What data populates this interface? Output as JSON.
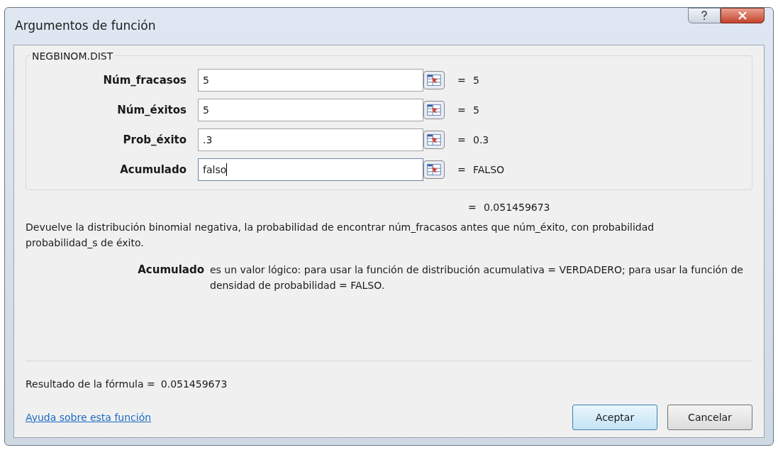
{
  "window": {
    "title": "Argumentos de función"
  },
  "function_name": "NEGBINOM.DIST",
  "arguments": [
    {
      "label": "Núm_fracasos",
      "value": "5",
      "result": "5",
      "focused": false
    },
    {
      "label": "Núm_éxitos",
      "value": "5",
      "result": "5",
      "focused": false
    },
    {
      "label": "Prob_éxito",
      "value": ".3",
      "result": "0.3",
      "focused": false
    },
    {
      "label": "Acumulado",
      "value": "falso",
      "result": "FALSO",
      "focused": true
    }
  ],
  "function_result": "0.051459673",
  "equals": "=",
  "description": "Devuelve la distribución binomial negativa, la probabilidad de encontrar núm_fracasos antes que núm_éxito, con probabilidad probabilidad_s de éxito.",
  "argument_help": {
    "name": "Acumulado",
    "text": "es un valor lógico: para usar la función de distribución acumulativa = VERDADERO; para usar la función de densidad de probabilidad = FALSO."
  },
  "formula_result": {
    "label": "Resultado de la fórmula =",
    "value": "0.051459673"
  },
  "help_link": "Ayuda sobre esta función",
  "buttons": [
    {
      "label": "Aceptar",
      "default": true
    },
    {
      "label": "Cancelar",
      "default": false
    }
  ]
}
